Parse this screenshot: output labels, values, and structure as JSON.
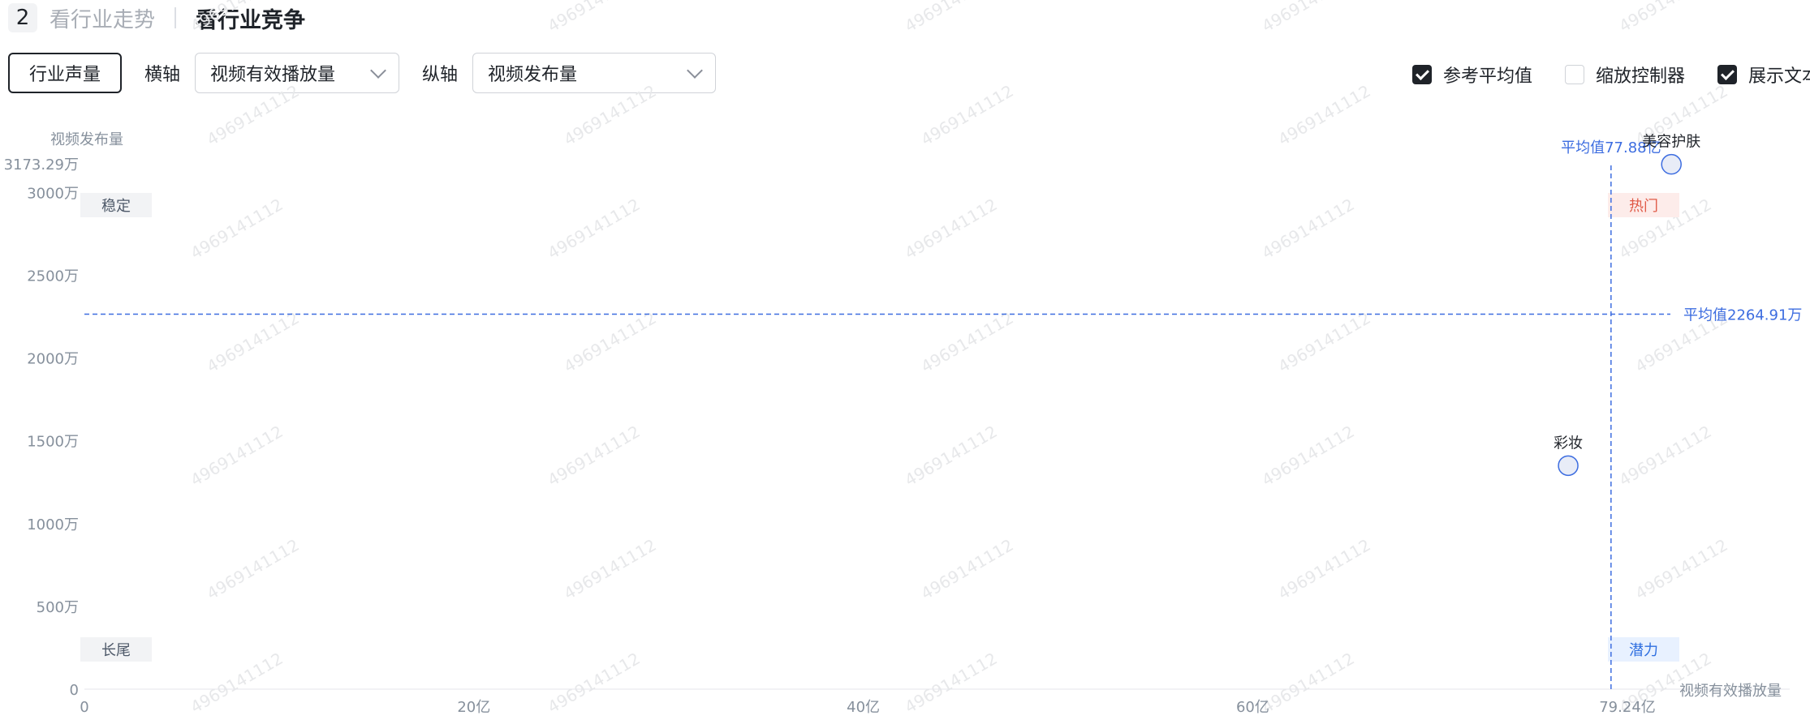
{
  "header": {
    "step_number": "2",
    "tab_trend": "看行业走势",
    "tab_competition": "看行业竞争"
  },
  "controls": {
    "industry_button": "行业声量",
    "x_axis_label": "横轴",
    "x_axis_value": "视频有效播放量",
    "y_axis_label": "纵轴",
    "y_axis_value": "视频发布量"
  },
  "options": {
    "reference_average": {
      "label": "参考平均值",
      "checked": true
    },
    "zoom_controller": {
      "label": "缩放控制器",
      "checked": false
    },
    "show_text": {
      "label": "展示文本",
      "checked": true
    }
  },
  "chart_data": {
    "type": "scatter",
    "xlabel": "视频有效播放量",
    "ylabel": "视频发布量",
    "x_unit": "亿",
    "y_unit": "万",
    "xlim": [
      0,
      79.24
    ],
    "ylim": [
      0,
      3173.29
    ],
    "x_ticks": [
      {
        "value": 0,
        "label": "0"
      },
      {
        "value": 20,
        "label": "20亿"
      },
      {
        "value": 40,
        "label": "40亿"
      },
      {
        "value": 60,
        "label": "60亿"
      },
      {
        "value": 79.24,
        "label": "79.24亿"
      }
    ],
    "y_ticks": [
      {
        "value": 0,
        "label": "0"
      },
      {
        "value": 500,
        "label": "500万"
      },
      {
        "value": 1000,
        "label": "1000万"
      },
      {
        "value": 1500,
        "label": "1500万"
      },
      {
        "value": 2000,
        "label": "2000万"
      },
      {
        "value": 2500,
        "label": "2500万"
      },
      {
        "value": 3000,
        "label": "3000万"
      },
      {
        "value": 3173.29,
        "label": "3173.29万"
      }
    ],
    "points": [
      {
        "name": "美容护肤",
        "x": 81.5,
        "y": 3170
      },
      {
        "name": "彩妆",
        "x": 76.2,
        "y": 1350
      }
    ],
    "average_lines": {
      "x": {
        "value": 78.4,
        "label": "平均值77.88亿"
      },
      "y": {
        "value": 2264.91,
        "label": "平均值2264.91万"
      }
    },
    "quadrants": {
      "top_left": "稳定",
      "top_right": "热门",
      "bottom_left": "长尾",
      "bottom_right": "潜力"
    },
    "colors": {
      "accent": "#3d6de0",
      "point_fill": "#e8ecf7",
      "hot_bg": "#fdecea",
      "hot_text": "#e05a47",
      "potential_bg": "#e8f1ff",
      "potential_text": "#2f6fe0",
      "neutral_bg": "#f2f3f5"
    },
    "grid": false,
    "watermark": "4969141112"
  }
}
